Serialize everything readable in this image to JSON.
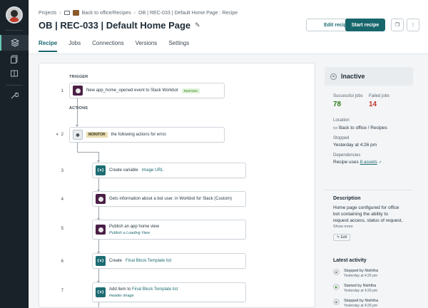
{
  "breadcrumb": {
    "root": "Projects",
    "folder": "Back to office/Recipes",
    "current": "OB | REC-033 | Default Home Page : Recipe"
  },
  "page": {
    "title": "OB | REC-033 | Default Home Page"
  },
  "toolbar": {
    "edit_label": "Edit recipe",
    "start_label": "Start recipe"
  },
  "tabs": [
    {
      "label": "Recipe",
      "active": true
    },
    {
      "label": "Jobs"
    },
    {
      "label": "Connections"
    },
    {
      "label": "Versions"
    },
    {
      "label": "Settings"
    }
  ],
  "recipe": {
    "trigger_label": "TRIGGER",
    "actions_label": "ACTIONS",
    "steps": [
      {
        "num": "1",
        "text_pre": "New app_home_opened event to Slack Workbot",
        "badge": "Real-time",
        "icon": "slack-bot-icon"
      },
      {
        "num": "2",
        "badge": "MONITOR",
        "text_post": "the following actions for error.",
        "icon": "monitor-icon"
      },
      {
        "num": "3",
        "text_pre": "Create variable",
        "highlight": "Image URL",
        "icon": "variable-icon"
      },
      {
        "num": "4",
        "text_pre": "Gets information about a bot user. in Workbot for Slack (Custom)",
        "icon": "slack-bot-icon"
      },
      {
        "num": "5",
        "text_pre": "Publish an app home view",
        "sub": "Publish a Loading View",
        "icon": "slack-bot-icon"
      },
      {
        "num": "6",
        "text_pre": "Create",
        "highlight": "Final Block Template list",
        "icon": "variable-icon"
      },
      {
        "num": "7",
        "text_pre": "Add item to",
        "highlight": "Final Block Template list",
        "sub": "Header image",
        "icon": "variable-icon"
      }
    ]
  },
  "sidebar_right": {
    "status": "Inactive",
    "successful_label": "Successful jobs",
    "successful_value": "78",
    "failed_label": "Failed jobs",
    "failed_value": "14",
    "location_label": "Location",
    "location_value": "Back to office / Recipes",
    "stopped_label": "Stopped",
    "stopped_value": "Yesterday at 4:26 pm",
    "dependencies_label": "Dependencies",
    "dependencies_pre": "Recipe uses",
    "dependencies_link": "8 assets",
    "description_title": "Description",
    "description_text": "Home page configured for office bot containing the ability to request access, status of request,",
    "show_more": "Show more",
    "edit_small": "Edit",
    "activity_title": "Latest activity",
    "activity": [
      {
        "title": "Stopped by Nishtha",
        "time": "Yesterday at 4:26 pm",
        "kind": "stop"
      },
      {
        "title": "Started by Nishtha",
        "time": "Yesterday at 4:26 pm",
        "kind": "play"
      },
      {
        "title": "Stopped by Nishtha",
        "time": "Yesterday at 4:26 pm",
        "kind": "stop"
      }
    ]
  },
  "colors": {
    "accent": "#17666c",
    "success": "#2f7d1c",
    "failure": "#c0352b",
    "nav_bg": "#1a2229"
  }
}
